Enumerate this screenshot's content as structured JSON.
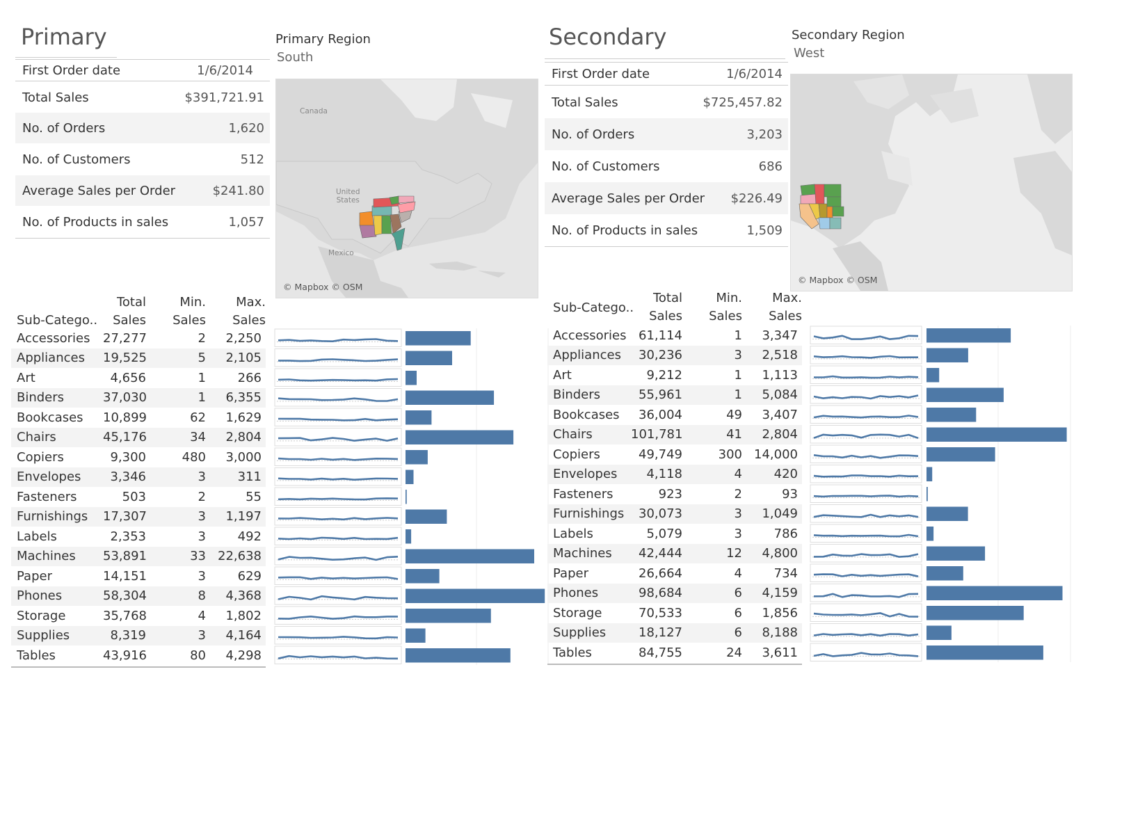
{
  "primary": {
    "title": "Primary",
    "region_label": "Primary Region",
    "region_value": "South",
    "kpis": [
      {
        "label": "First Order date",
        "value": "1/6/2014"
      },
      {
        "label": "Total Sales",
        "value": "$391,721.91"
      },
      {
        "label": "No. of  Orders",
        "value": "1,620"
      },
      {
        "label": "No. of Customers",
        "value": "512"
      },
      {
        "label": "Average Sales per Order",
        "value": "$241.80"
      },
      {
        "label": "No. of Products in sales",
        "value": "1,057"
      }
    ],
    "map": {
      "credit": "© Mapbox © OSM",
      "labels": {
        "canada": "Canada",
        "us": "United\nStates",
        "mexico": "Mexico"
      }
    }
  },
  "secondary": {
    "title": "Secondary",
    "region_label": "Secondary Region",
    "region_value": "West",
    "kpis": [
      {
        "label": "First Order date",
        "value": "1/6/2014"
      },
      {
        "label": "Total Sales",
        "value": "$725,457.82"
      },
      {
        "label": "No. of  Orders",
        "value": "3,203"
      },
      {
        "label": "No. of Customers",
        "value": "686"
      },
      {
        "label": "Average Sales per Order",
        "value": "$226.49"
      },
      {
        "label": "No. of Products in sales",
        "value": "1,509"
      }
    ],
    "map": {
      "credit": "© Mapbox © OSM"
    }
  },
  "table_headers": {
    "subcat": "Sub-Catego..",
    "total_1": "Total",
    "total_2": "Sales",
    "min_1": "Min.",
    "min_2": "Sales",
    "max_1": "Max.",
    "max_2": "Sales"
  },
  "colors": {
    "bar": "#4e79a7",
    "line": "#4e79a7",
    "shade": "#f3f3f3"
  },
  "chart_data": [
    {
      "type": "table",
      "title": "",
      "region": "South",
      "columns": [
        "Sub-Catego..",
        "Total Sales",
        "Min. Sales",
        "Max. Sales"
      ],
      "rows": [
        {
          "name": "Accessories",
          "total": "27,277",
          "min": "2",
          "max": "2,250",
          "value": 27277
        },
        {
          "name": "Appliances",
          "total": "19,525",
          "min": "5",
          "max": "2,105",
          "value": 19525
        },
        {
          "name": "Art",
          "total": "4,656",
          "min": "1",
          "max": "266",
          "value": 4656
        },
        {
          "name": "Binders",
          "total": "37,030",
          "min": "1",
          "max": "6,355",
          "value": 37030
        },
        {
          "name": "Bookcases",
          "total": "10,899",
          "min": "62",
          "max": "1,629",
          "value": 10899
        },
        {
          "name": "Chairs",
          "total": "45,176",
          "min": "34",
          "max": "2,804",
          "value": 45176
        },
        {
          "name": "Copiers",
          "total": "9,300",
          "min": "480",
          "max": "3,000",
          "value": 9300
        },
        {
          "name": "Envelopes",
          "total": "3,346",
          "min": "3",
          "max": "311",
          "value": 3346
        },
        {
          "name": "Fasteners",
          "total": "503",
          "min": "2",
          "max": "55",
          "value": 503
        },
        {
          "name": "Furnishings",
          "total": "17,307",
          "min": "3",
          "max": "1,197",
          "value": 17307
        },
        {
          "name": "Labels",
          "total": "2,353",
          "min": "3",
          "max": "492",
          "value": 2353
        },
        {
          "name": "Machines",
          "total": "53,891",
          "min": "33",
          "max": "22,638",
          "value": 53891
        },
        {
          "name": "Paper",
          "total": "14,151",
          "min": "3",
          "max": "629",
          "value": 14151
        },
        {
          "name": "Phones",
          "total": "58,304",
          "min": "8",
          "max": "4,368",
          "value": 58304
        },
        {
          "name": "Storage",
          "total": "35,768",
          "min": "4",
          "max": "1,802",
          "value": 35768
        },
        {
          "name": "Supplies",
          "total": "8,319",
          "min": "3",
          "max": "4,164",
          "value": 8319
        },
        {
          "name": "Tables",
          "total": "43,916",
          "min": "80",
          "max": "4,298",
          "value": 43916
        }
      ],
      "bar_xlim": [
        0,
        60000
      ]
    },
    {
      "type": "table",
      "title": "",
      "region": "West",
      "columns": [
        "Sub-Catego..",
        "Total Sales",
        "Min. Sales",
        "Max. Sales"
      ],
      "rows": [
        {
          "name": "Accessories",
          "total": "61,114",
          "min": "1",
          "max": "3,347",
          "value": 61114
        },
        {
          "name": "Appliances",
          "total": "30,236",
          "min": "3",
          "max": "2,518",
          "value": 30236
        },
        {
          "name": "Art",
          "total": "9,212",
          "min": "1",
          "max": "1,113",
          "value": 9212
        },
        {
          "name": "Binders",
          "total": "55,961",
          "min": "1",
          "max": "5,084",
          "value": 55961
        },
        {
          "name": "Bookcases",
          "total": "36,004",
          "min": "49",
          "max": "3,407",
          "value": 36004
        },
        {
          "name": "Chairs",
          "total": "101,781",
          "min": "41",
          "max": "2,804",
          "value": 101781
        },
        {
          "name": "Copiers",
          "total": "49,749",
          "min": "300",
          "max": "14,000",
          "value": 49749
        },
        {
          "name": "Envelopes",
          "total": "4,118",
          "min": "4",
          "max": "420",
          "value": 4118
        },
        {
          "name": "Fasteners",
          "total": "923",
          "min": "2",
          "max": "93",
          "value": 923
        },
        {
          "name": "Furnishings",
          "total": "30,073",
          "min": "3",
          "max": "1,049",
          "value": 30073
        },
        {
          "name": "Labels",
          "total": "5,079",
          "min": "3",
          "max": "786",
          "value": 5079
        },
        {
          "name": "Machines",
          "total": "42,444",
          "min": "12",
          "max": "4,800",
          "value": 42444
        },
        {
          "name": "Paper",
          "total": "26,664",
          "min": "4",
          "max": "734",
          "value": 26664
        },
        {
          "name": "Phones",
          "total": "98,684",
          "min": "6",
          "max": "4,159",
          "value": 98684
        },
        {
          "name": "Storage",
          "total": "70,533",
          "min": "6",
          "max": "1,856",
          "value": 70533
        },
        {
          "name": "Supplies",
          "total": "18,127",
          "min": "6",
          "max": "8,188",
          "value": 18127
        },
        {
          "name": "Tables",
          "total": "84,755",
          "min": "24",
          "max": "3,611",
          "value": 84755
        }
      ],
      "bar_xlim": [
        0,
        105000
      ]
    }
  ]
}
